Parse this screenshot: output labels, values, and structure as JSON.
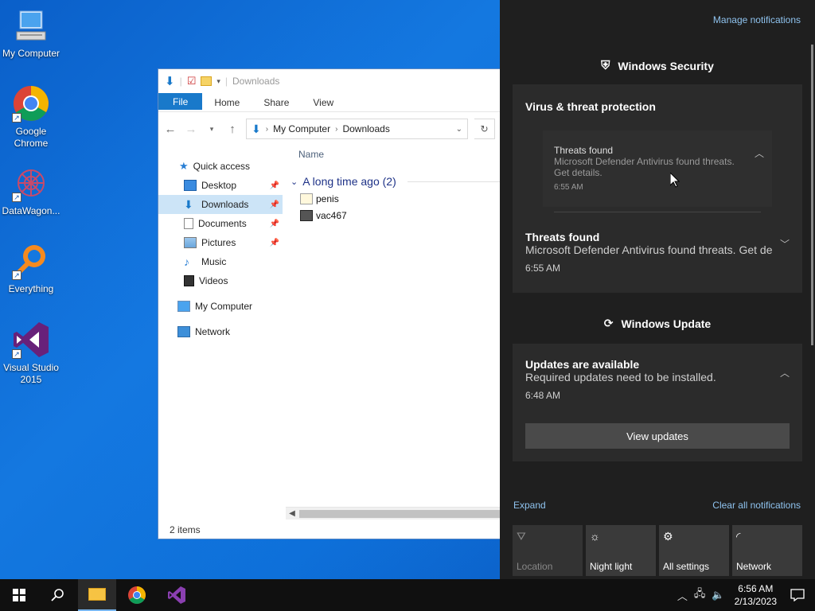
{
  "desktop": {
    "icons": [
      {
        "label": "My Computer"
      },
      {
        "label": "Google Chrome"
      },
      {
        "label": "DataWagon..."
      },
      {
        "label": "Everything"
      },
      {
        "label": "Visual Studio 2015"
      }
    ]
  },
  "explorer": {
    "title": "Downloads",
    "ribbon_tabs": [
      "File",
      "Home",
      "Share",
      "View"
    ],
    "breadcrumb": [
      "My Computer",
      "Downloads"
    ],
    "nav": {
      "quick_access": "Quick access",
      "items": [
        "Desktop",
        "Downloads",
        "Documents",
        "Pictures",
        "Music",
        "Videos"
      ],
      "my_computer": "My Computer",
      "network": "Network"
    },
    "column_name": "Name",
    "group_label": "A long time ago (2)",
    "files": [
      "penis",
      "vac467"
    ],
    "status": "2 items"
  },
  "action_center": {
    "manage": "Manage notifications",
    "security_app": "Windows Security",
    "security_card": {
      "header": "Virus & threat protection",
      "inner_title": "Threats found",
      "inner_body_1": "Microsoft Defender Antivirus found threats.",
      "inner_body_2": "Get details.",
      "inner_time": "6:55 AM",
      "title": "Threats found",
      "body": "Microsoft Defender Antivirus found threats. Get details.",
      "time": "6:55 AM"
    },
    "update_app": "Windows Update",
    "update_card": {
      "title": "Updates are available",
      "body": "Required updates need to be installed.",
      "time": "6:48 AM",
      "button": "View updates"
    },
    "expand": "Expand",
    "clear_all": "Clear all notifications",
    "quick_actions": [
      "Location",
      "Night light",
      "All settings",
      "Network"
    ]
  },
  "taskbar": {
    "time": "6:56 AM",
    "date": "2/13/2023"
  }
}
